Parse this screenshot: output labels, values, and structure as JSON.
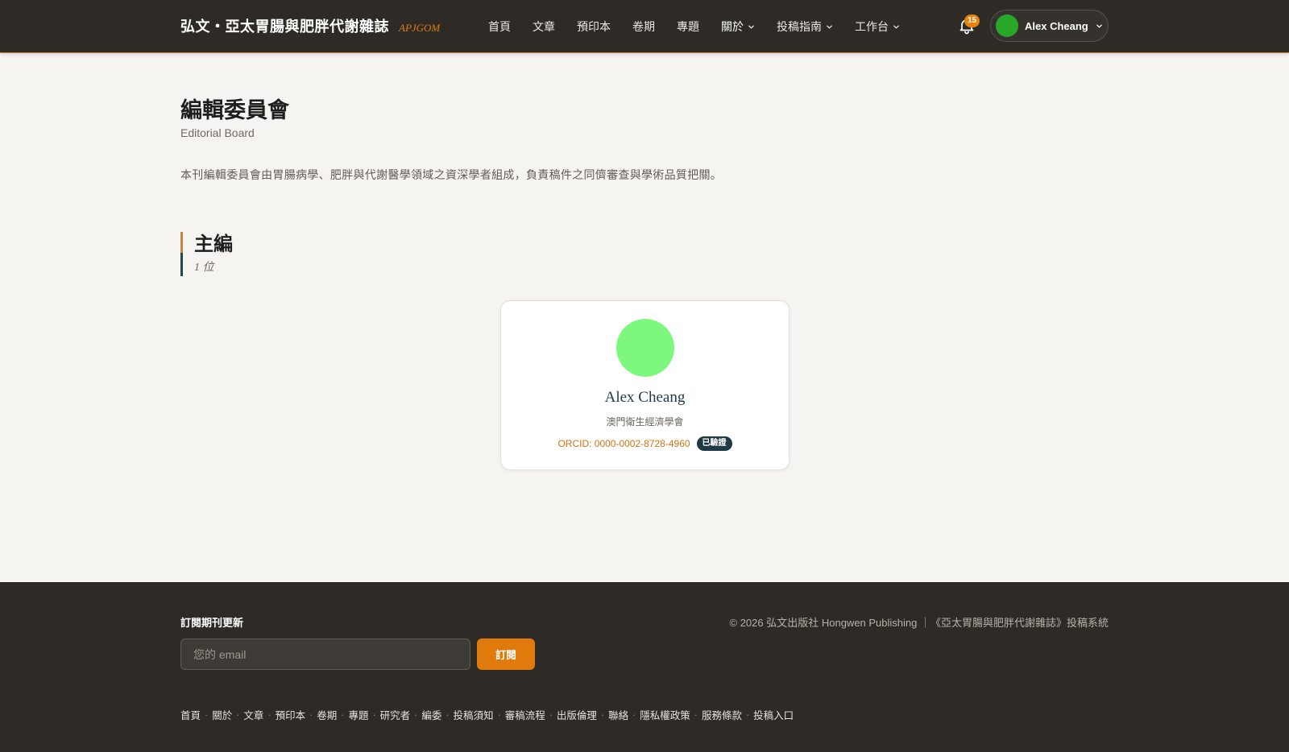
{
  "header": {
    "brand_title": "弘文・亞太胃腸與肥胖代謝雜誌",
    "brand_abbr": "APJGOM",
    "nav": [
      {
        "label": "首頁"
      },
      {
        "label": "文章"
      },
      {
        "label": "預印本"
      },
      {
        "label": "卷期"
      },
      {
        "label": "專題"
      },
      {
        "label": "關於"
      },
      {
        "label": "投稿指南"
      },
      {
        "label": "工作台"
      }
    ],
    "notification_count": "15",
    "user_name": "Alex Cheang"
  },
  "main": {
    "title": "編輯委員會",
    "subtitle": "Editorial Board",
    "description": "本刊編輯委員會由胃腸病學、肥胖與代謝醫學領域之資深學者組成，負責稿件之同儕審查與學術品質把關。",
    "section": {
      "title": "主編",
      "count": "1 位"
    },
    "member": {
      "name": "Alex Cheang",
      "affiliation": "澳門衛生經濟學會",
      "orcid": "ORCID: 0000-0002-8728-4960",
      "verified_label": "已驗證"
    }
  },
  "footer": {
    "subscribe_label": "訂閱期刊更新",
    "email_placeholder": "您的 email",
    "subscribe_button": "訂閱",
    "copyright": "© 2026 弘文出版社 Hongwen Publishing ｜《亞太胃腸與肥胖代謝雜誌》投稿系統",
    "links": [
      "首頁",
      "關於",
      "文章",
      "預印本",
      "卷期",
      "專題",
      "研究者",
      "編委",
      "投稿須知",
      "審稿流程",
      "出版倫理",
      "聯絡",
      "隱私權政策",
      "服務條款",
      "投稿入口"
    ]
  },
  "colors": {
    "nav_bg": "#2e2b27",
    "accent": "#e07a0c",
    "user_avatar": "#28a828",
    "member_avatar": "#7ef77e",
    "verified_badge": "#1f3a45"
  }
}
